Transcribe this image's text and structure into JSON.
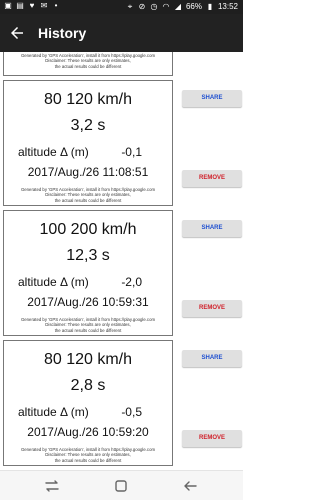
{
  "status_bar": {
    "battery": "66%",
    "time": "13:52"
  },
  "app_bar": {
    "title": "History"
  },
  "disclaimer": {
    "line1": "Generated by 'GPS Acceleration', install it from https://play.google.com",
    "line2": "Disclaimer: These results are only estimates,",
    "line3": "the actual results could be different"
  },
  "entries": [
    {
      "speed": "80 120 km/h",
      "time": "3,2 s",
      "altitude_label": "altitude Δ (m)",
      "altitude_value": "-0,1",
      "datetime": "2017/Aug./26 11:08:51",
      "share_label": "SHARE",
      "remove_label": "REMOVE"
    },
    {
      "speed": "100 200 km/h",
      "time": "12,3 s",
      "altitude_label": "altitude Δ (m)",
      "altitude_value": "-2,0",
      "datetime": "2017/Aug./26 10:59:31",
      "share_label": "SHARE",
      "remove_label": "REMOVE"
    },
    {
      "speed": "80 120 km/h",
      "time": "2,8 s",
      "altitude_label": "altitude Δ (m)",
      "altitude_value": "-0,5",
      "datetime": "2017/Aug./26 10:59:20",
      "share_label": "SHARE",
      "remove_label": "REMOVE"
    }
  ],
  "colors": {
    "share": "#1e4fd0",
    "remove": "#d0202a",
    "app_bar": "#222222"
  }
}
